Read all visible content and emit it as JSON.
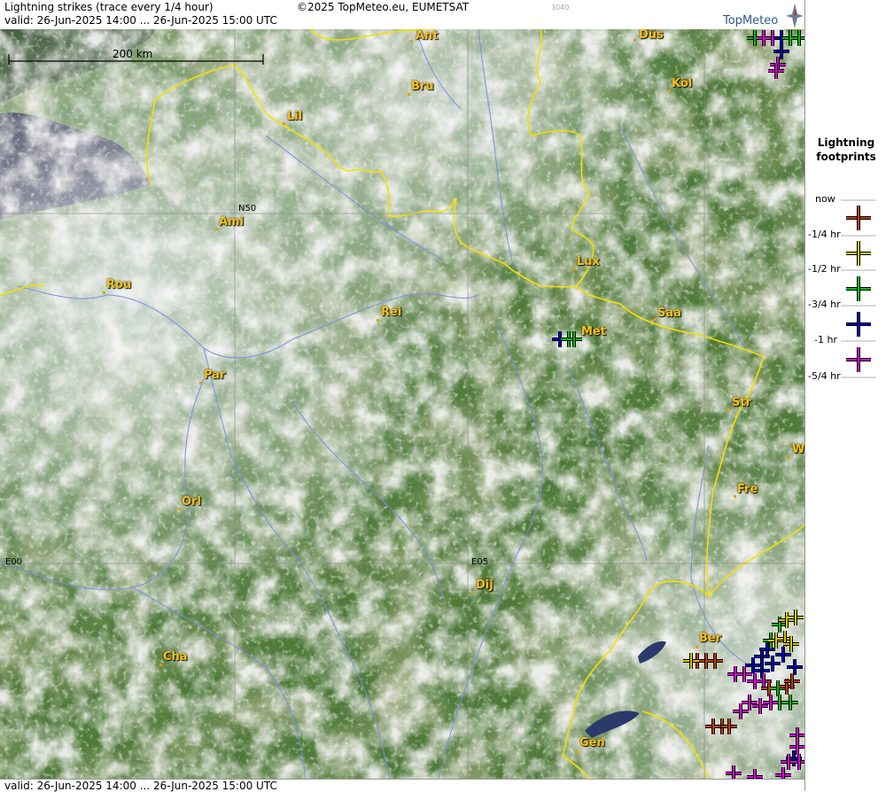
{
  "header": {
    "title": "Lightning strikes (trace every 1/4 hour)",
    "valid": "valid:  26-Jun-2025 14:00 ... 26-Jun-2025 15:00 UTC",
    "copyright": "©2025 TopMeteo.eu, EUMETSAT",
    "sat_id": "3040",
    "logo_text": "TopMeteo"
  },
  "footer": {
    "valid": "valid:  26-Jun-2025 14:00 ... 26-Jun-2025 15:00 UTC"
  },
  "scale": {
    "label": "200 km"
  },
  "grid_labels": {
    "lat": "N50",
    "lon0": "E00",
    "lon5": "E05"
  },
  "cities": [
    {
      "name": "Ant"
    },
    {
      "name": "Düs"
    },
    {
      "name": "Bru"
    },
    {
      "name": "Köl"
    },
    {
      "name": "Lil"
    },
    {
      "name": "Ami"
    },
    {
      "name": "Lux"
    },
    {
      "name": "Rou"
    },
    {
      "name": "Rei"
    },
    {
      "name": "Saa"
    },
    {
      "name": "Met"
    },
    {
      "name": "Par"
    },
    {
      "name": "Str"
    },
    {
      "name": "W"
    },
    {
      "name": "Fre"
    },
    {
      "name": "Orl"
    },
    {
      "name": "Dij"
    },
    {
      "name": "Ber"
    },
    {
      "name": "Cha"
    },
    {
      "name": "Gen"
    }
  ],
  "legend": {
    "title_line1": "Lightning",
    "title_line2": "footprints",
    "items": [
      {
        "label": "now",
        "color": "#c04000"
      },
      {
        "label": "-1/4 hr",
        "color": "#d8c800"
      },
      {
        "label": "-1/2 hr",
        "color": "#00c000"
      },
      {
        "label": "-3/4 hr",
        "color": "#0000c0"
      },
      {
        "label": "-1 hr",
        "color": "#e000e0"
      },
      {
        "label": "-5/4 hr",
        "color": ""
      }
    ]
  },
  "colors": {
    "border": "#f4e000",
    "river": "#7a8ce6",
    "grid": "#888888",
    "city": "#f0c020"
  }
}
